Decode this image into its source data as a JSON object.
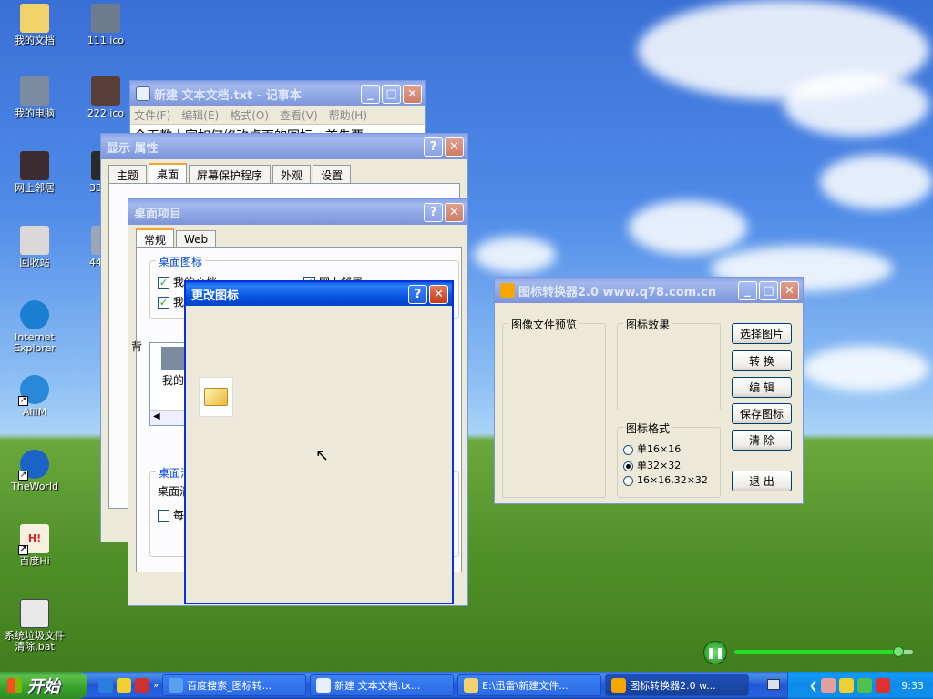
{
  "desktop": {
    "icons": [
      {
        "label": "我的文档",
        "icon": "my-documents-icon",
        "color": "#f2d26a"
      },
      {
        "label": "111.ico",
        "icon": "photo-icon",
        "color": "#6d7b8e"
      },
      {
        "label": "我的电脑",
        "icon": "my-computer-icon",
        "color": "#7b8ca0"
      },
      {
        "label": "222.ico",
        "icon": "photo-icon",
        "color": "#5a3e3a"
      },
      {
        "label": "网上邻居",
        "icon": "network-places-icon",
        "color": "#3d2d32"
      },
      {
        "label": "33",
        "icon": "photo-icon",
        "color": "#2a2a2a"
      },
      {
        "label": "回收站",
        "icon": "recycle-bin-icon",
        "color": "#ddd8d8"
      },
      {
        "label": "44",
        "icon": "photo-icon",
        "color": "#9aa7b8"
      },
      {
        "label": "Internet Explorer",
        "icon": "internet-explorer-icon",
        "color": "#1b7fd1"
      },
      {
        "label": "AliIM",
        "icon": "aliim-icon",
        "color": "#2a88d8"
      },
      {
        "label": "TheWorld",
        "icon": "theworld-browser-icon",
        "color": "#1c63c8"
      },
      {
        "label": "百度Hi",
        "icon": "baidu-hi-icon",
        "color": "#f5f0e0"
      },
      {
        "label": "系统垃圾文件清除.bat",
        "icon": "batch-file-icon",
        "color": "#e9e9e9"
      }
    ]
  },
  "notepad": {
    "title": "新建 文本文档.txt - 记事本",
    "menu": [
      "文件(F)",
      "编辑(E)",
      "格式(O)",
      "查看(V)",
      "帮助(H)"
    ],
    "content": "今天教大家如何修改桌面的图标，首先要"
  },
  "display_props": {
    "title": "显示 属性",
    "tabs": [
      "主题",
      "桌面",
      "屏幕保护程序",
      "外观",
      "设置"
    ]
  },
  "desktop_items": {
    "title": "桌面项目",
    "tabs": [
      "常规",
      "Web"
    ],
    "group_icons": "桌面图标",
    "check1": "我的文档",
    "check2": "我的电脑",
    "check3": "网上邻居",
    "preview_item": "我的",
    "cleanup_group": "桌面清理",
    "cleanup_text": "桌面清理向导",
    "cleanup_check": "每",
    "side_label": "背"
  },
  "change_icon": {
    "title": "更改图标"
  },
  "converter": {
    "title": "图标转换器2.0  www.q78.com.cn",
    "preview_group": "图像文件预览",
    "effect_group": "图标效果",
    "format_group": "图标格式",
    "formats": [
      "单16×16",
      "单32×32",
      "16×16,32×32"
    ],
    "selected_format": 1,
    "buttons": [
      "选择图片",
      "转  换",
      "编  辑",
      "保存图标",
      "清  除",
      "退  出"
    ]
  },
  "taskbar": {
    "start_label": "开始",
    "tasks": [
      "百度搜索_图标转...",
      "新建 文本文档.tx...",
      "E:\\迅雷\\新建文件...",
      "图标转换器2.0  w..."
    ],
    "active_task": 3,
    "time": "9:33"
  },
  "media_player": {
    "volume_fraction": 0.92
  }
}
